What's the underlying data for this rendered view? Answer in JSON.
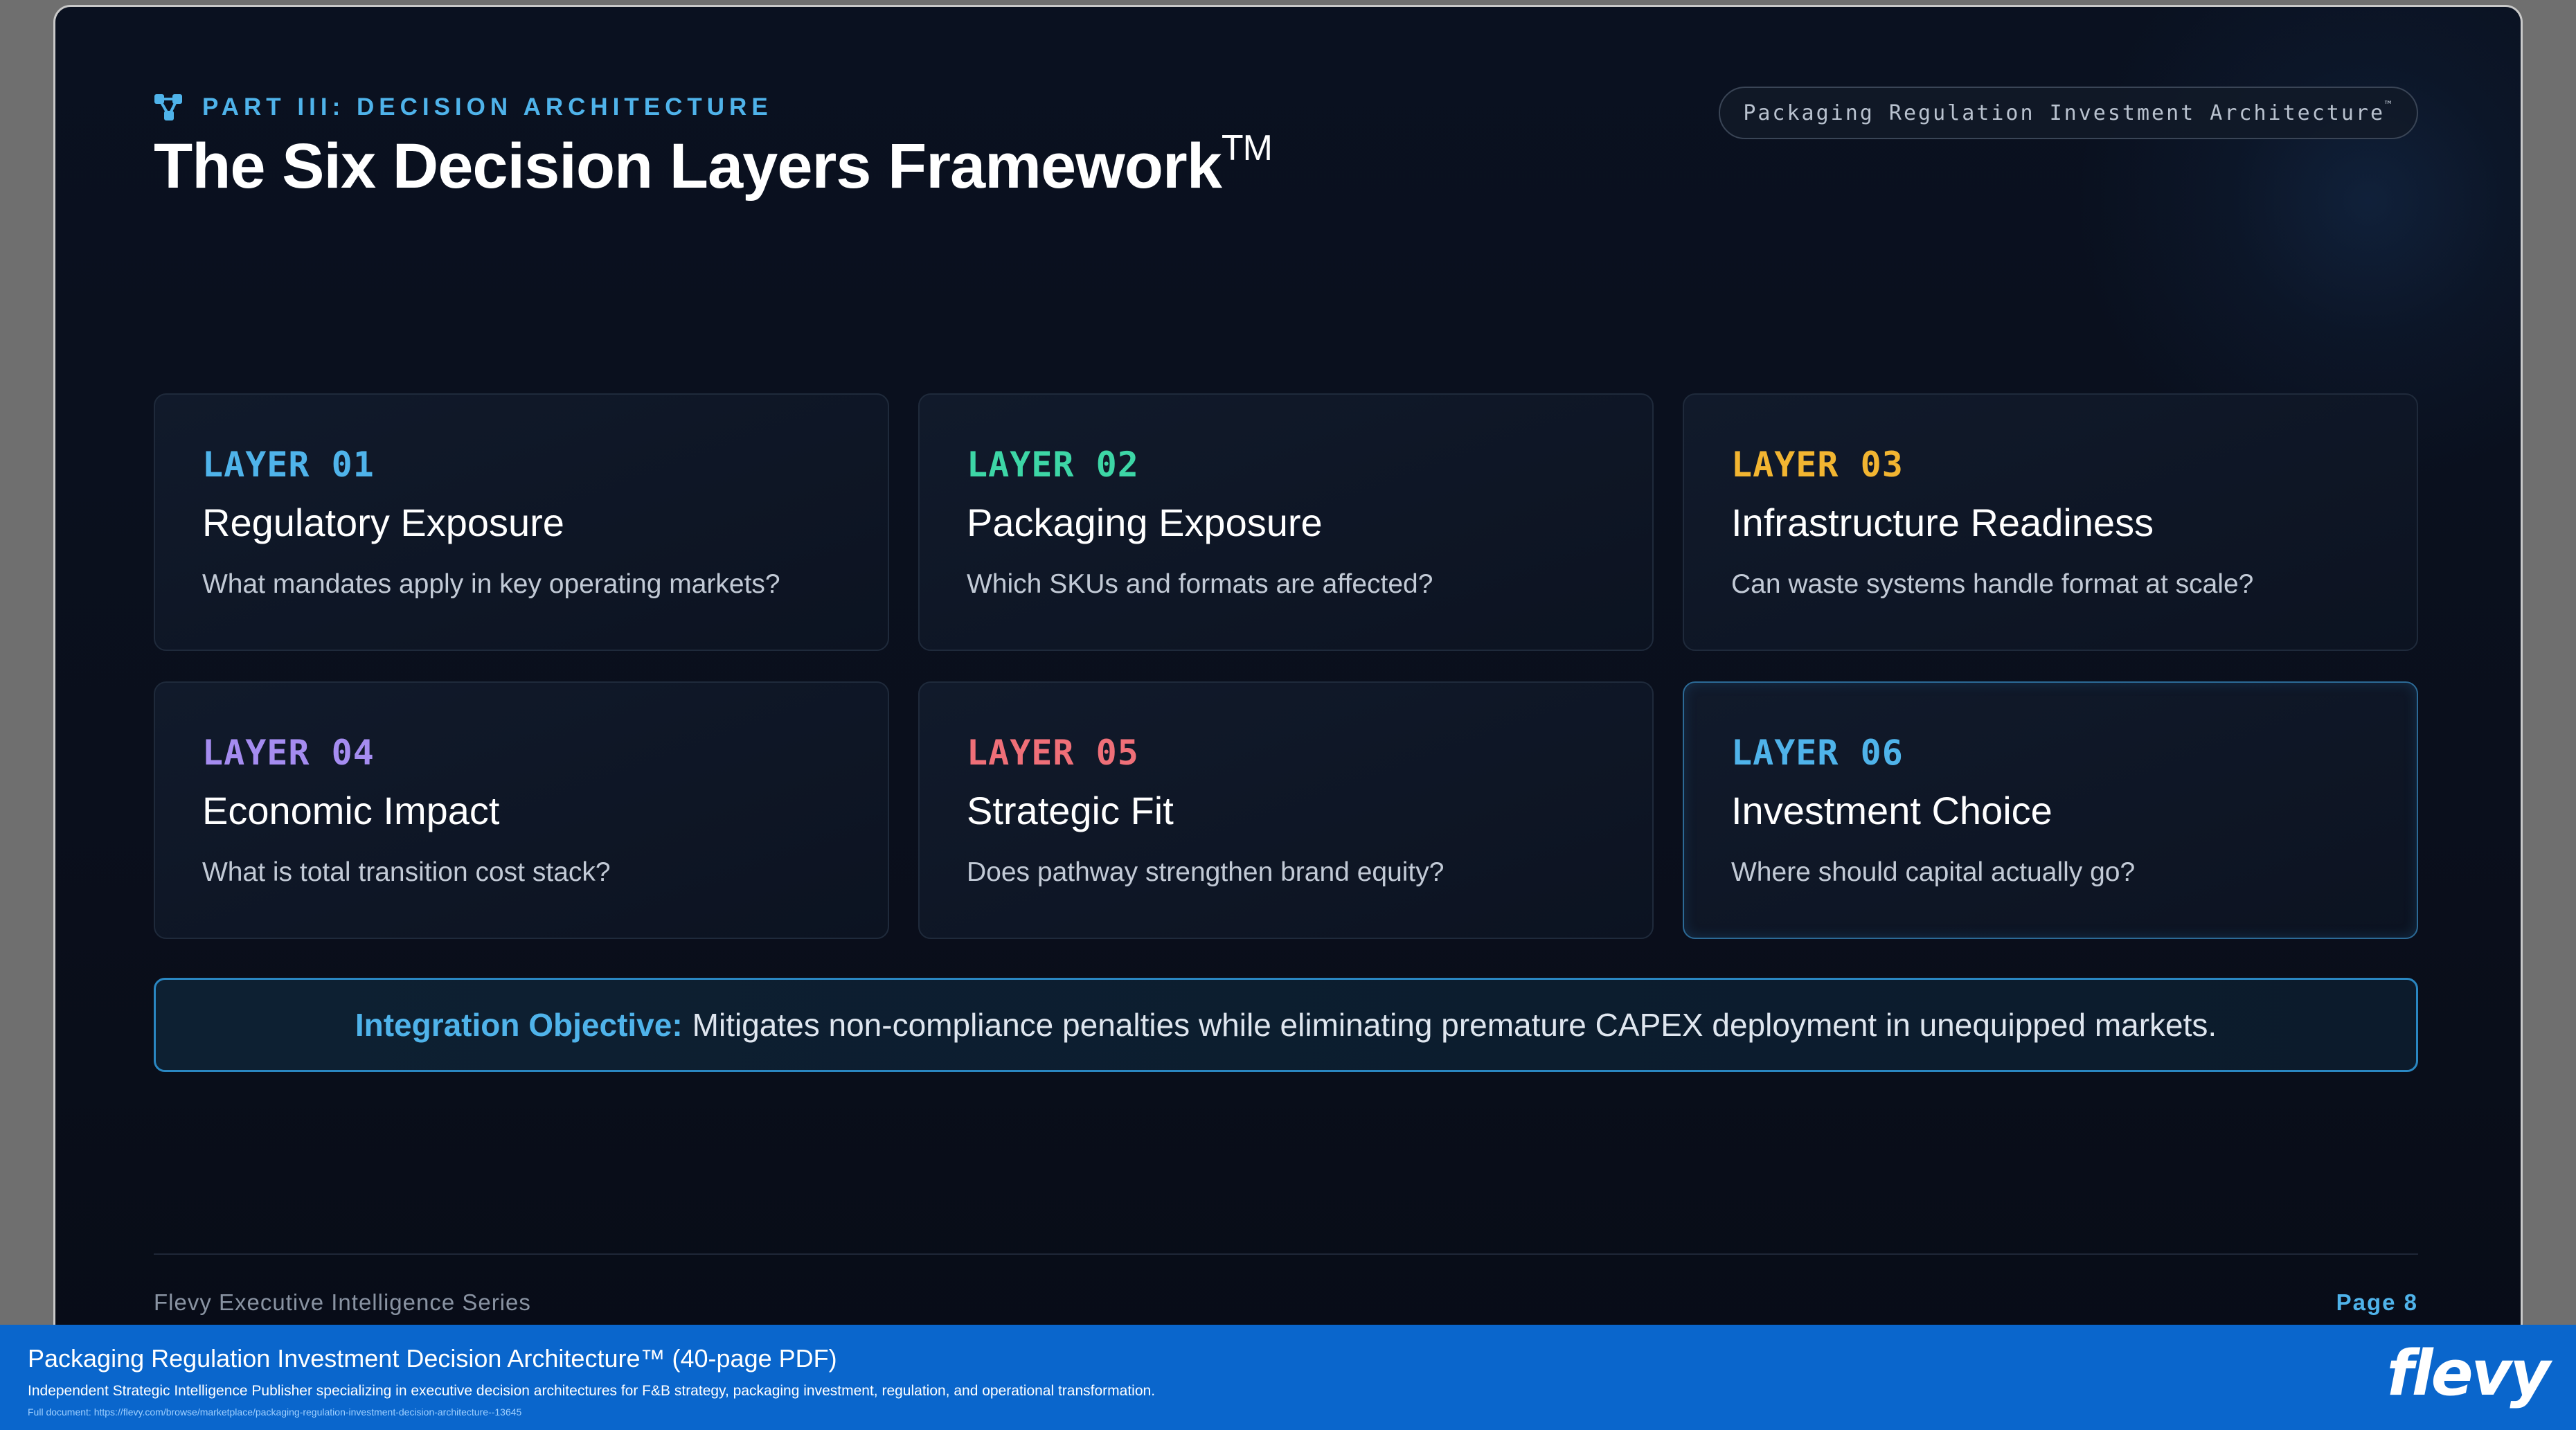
{
  "header": {
    "kicker": "PART III: DECISION ARCHITECTURE",
    "kicker_icon": "network-nodes-icon",
    "title": "The Six Decision Layers Framework",
    "title_mark": "TM",
    "pill_text": "Packaging Regulation Investment Architecture",
    "pill_mark": "™"
  },
  "layers": [
    {
      "label": "LAYER 01",
      "title": "Regulatory Exposure",
      "question": "What mandates apply in key operating markets?",
      "color": "#4fb3ea"
    },
    {
      "label": "LAYER 02",
      "title": "Packaging Exposure",
      "question": "Which SKUs and formats are affected?",
      "color": "#3dd6a6"
    },
    {
      "label": "LAYER 03",
      "title": "Infrastructure Readiness",
      "question": "Can waste systems handle format at scale?",
      "color": "#f2b531"
    },
    {
      "label": "LAYER 04",
      "title": "Economic Impact",
      "question": "What is total transition cost stack?",
      "color": "#a58cf0"
    },
    {
      "label": "LAYER 05",
      "title": "Strategic Fit",
      "question": "Does pathway strengthen brand equity?",
      "color": "#ef6f78"
    },
    {
      "label": "LAYER 06",
      "title": "Investment Choice",
      "question": "Where should capital actually go?",
      "color": "#4fb3ea"
    }
  ],
  "objective": {
    "label": "Integration Objective:",
    "text": "Mitigates non-compliance penalties while eliminating premature CAPEX deployment in unequipped markets."
  },
  "slide_footer": {
    "series": "Flevy Executive Intelligence Series",
    "page": "Page 8"
  },
  "footer": {
    "title": "Packaging Regulation Investment Decision Architecture™",
    "pages": "(40-page PDF)",
    "description": "Independent Strategic Intelligence Publisher specializing in executive decision architectures for F&B strategy, packaging investment, regulation, and operational transformation.",
    "link": "Full document: https://flevy.com/browse/marketplace/packaging-regulation-investment-decision-architecture--13645",
    "logo": "flevy"
  }
}
